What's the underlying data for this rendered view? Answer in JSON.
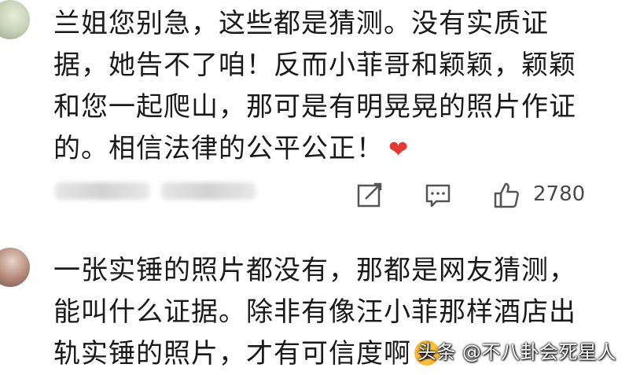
{
  "comments": [
    {
      "text": "兰姐您别急，这些都是猜测。没有实质证据，她告不了咱！反而小菲哥和颖颖，颖颖和您一起爬山，那可是有明晃晃的照片作证的。相信法律的公平公正！",
      "emoji": "❤"
    },
    {
      "text": "一张实锤的照片都没有，那都是网友猜测，能叫什么证据。除非有像汪小菲那样酒店出轨实锤的照片，才有可信度啊"
    }
  ],
  "actions": {
    "like_count": "2780"
  },
  "watermark": "头条 @不八卦会死星人",
  "colors": {
    "heart": "#e53935",
    "icon": "#555555",
    "text": "#1a1a1a"
  }
}
